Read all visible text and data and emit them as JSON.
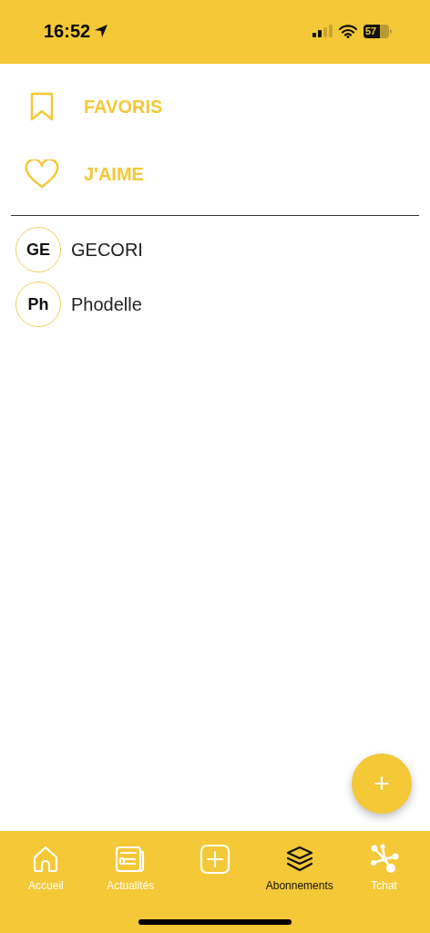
{
  "status_bar": {
    "time": "16:52",
    "battery": "57"
  },
  "menu": [
    {
      "kind": "bookmark",
      "label": "FAVORIS"
    },
    {
      "kind": "heart",
      "label": "J'AIME"
    }
  ],
  "subscriptions": [
    {
      "initials": "GE",
      "name": "GECORI"
    },
    {
      "initials": "Ph",
      "name": "Phodelle"
    }
  ],
  "fab": {
    "label": "+"
  },
  "tabs": [
    {
      "kind": "home",
      "label": "Accueil",
      "selected": false
    },
    {
      "kind": "news",
      "label": "Actualités",
      "selected": false
    },
    {
      "kind": "add",
      "selected": false
    },
    {
      "kind": "layers",
      "label": "Abonnements",
      "selected": true
    },
    {
      "kind": "network",
      "label": "Tchat",
      "selected": false
    }
  ]
}
